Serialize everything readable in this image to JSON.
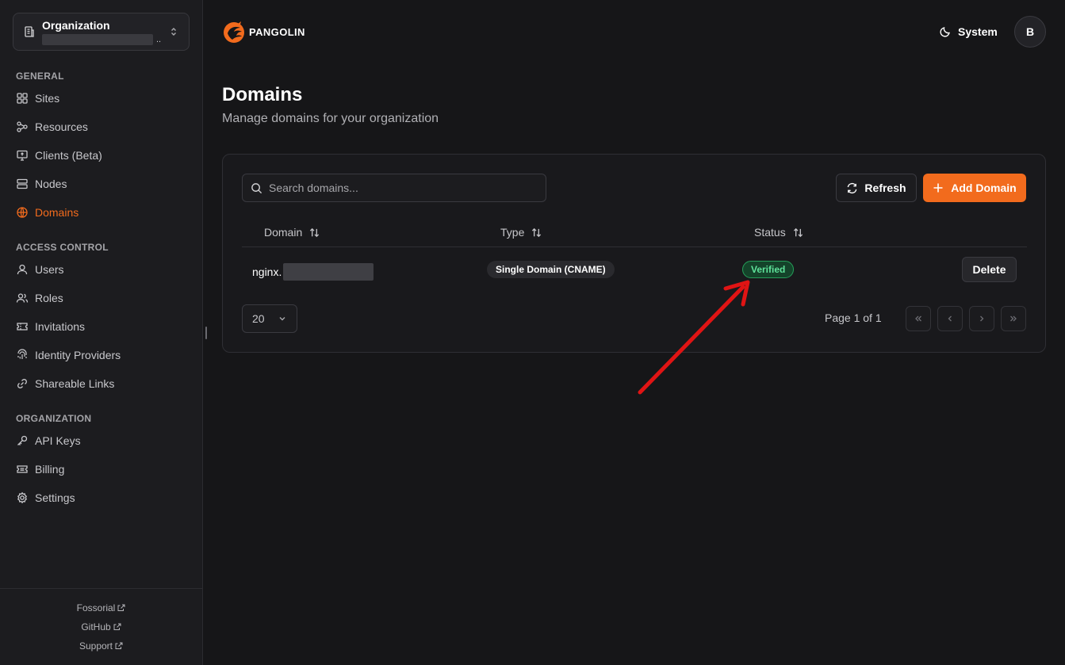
{
  "sidebar": {
    "org": {
      "title": "Organization",
      "subtitle_suffix": ".."
    },
    "sections": [
      {
        "title": "GENERAL",
        "items": [
          {
            "label": "Sites",
            "icon": "sites-icon",
            "active": false
          },
          {
            "label": "Resources",
            "icon": "resources-icon",
            "active": false
          },
          {
            "label": "Clients (Beta)",
            "icon": "clients-icon",
            "active": false
          },
          {
            "label": "Nodes",
            "icon": "nodes-icon",
            "active": false
          },
          {
            "label": "Domains",
            "icon": "globe-icon",
            "active": true
          }
        ]
      },
      {
        "title": "ACCESS CONTROL",
        "items": [
          {
            "label": "Users",
            "icon": "user-icon",
            "active": false
          },
          {
            "label": "Roles",
            "icon": "users-icon",
            "active": false
          },
          {
            "label": "Invitations",
            "icon": "ticket-icon",
            "active": false
          },
          {
            "label": "Identity Providers",
            "icon": "fingerprint-icon",
            "active": false
          },
          {
            "label": "Shareable Links",
            "icon": "link-icon",
            "active": false
          }
        ]
      },
      {
        "title": "ORGANIZATION",
        "items": [
          {
            "label": "API Keys",
            "icon": "key-icon",
            "active": false
          },
          {
            "label": "Billing",
            "icon": "billing-icon",
            "active": false
          },
          {
            "label": "Settings",
            "icon": "gear-icon",
            "active": false
          }
        ]
      }
    ],
    "footer_links": [
      {
        "label": "Fossorial",
        "icon": "external-link-icon"
      },
      {
        "label": "GitHub",
        "icon": "external-link-icon"
      },
      {
        "label": "Support",
        "icon": "external-link-icon"
      }
    ]
  },
  "header": {
    "brand": "PANGOLIN",
    "theme_label": "System",
    "avatar_initial": "B"
  },
  "page": {
    "title": "Domains",
    "subtitle": "Manage domains for your organization"
  },
  "toolbar": {
    "search_placeholder": "Search domains...",
    "refresh_label": "Refresh",
    "add_label": "Add Domain"
  },
  "table": {
    "columns": [
      "Domain",
      "Type",
      "Status"
    ],
    "rows": [
      {
        "domain_prefix": "nginx.",
        "type": "Single Domain (CNAME)",
        "status": "Verified",
        "action": "Delete"
      }
    ]
  },
  "pagination": {
    "page_size": "20",
    "page_info": "Page 1 of 1"
  },
  "colors": {
    "accent": "#f26b1d",
    "background": "#161618",
    "status_verified": "#5fe29a",
    "annotation": "#e01414"
  }
}
